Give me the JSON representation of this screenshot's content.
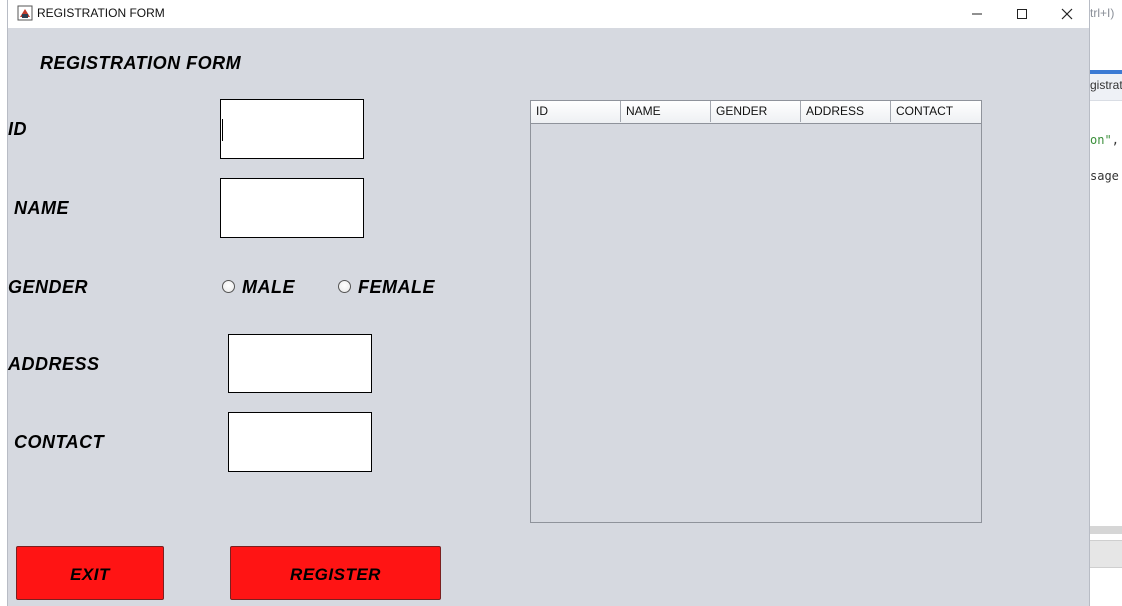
{
  "background_app": {
    "hint_text": "trl+I)",
    "tab_text": "gistrati",
    "code_line_1_string": "on\"",
    "code_line_1_punct": ",",
    "code_line_2": "sage"
  },
  "window": {
    "title": "REGISTRATION FORM",
    "icons": {
      "app": "java-app-icon",
      "minimize": "minimize-icon",
      "maximize": "maximize-icon",
      "close": "close-icon"
    }
  },
  "form": {
    "heading": "REGISTRATION FORM",
    "labels": {
      "id": "ID",
      "name": "NAME",
      "gender": "GENDER",
      "address": "ADDRESS",
      "contact": "CONTACT"
    },
    "values": {
      "id": "",
      "name": "",
      "address": "",
      "contact": ""
    },
    "gender_options": [
      "MALE",
      "FEMALE"
    ],
    "gender_selected": null
  },
  "table": {
    "columns": [
      "ID",
      "NAME",
      "GENDER",
      "ADDRESS",
      "CONTACT"
    ],
    "rows": []
  },
  "buttons": {
    "exit": "EXIT",
    "register": "REGISTER"
  },
  "colors": {
    "window_bg": "#d6d9e0",
    "button_red": "#ff1414"
  }
}
